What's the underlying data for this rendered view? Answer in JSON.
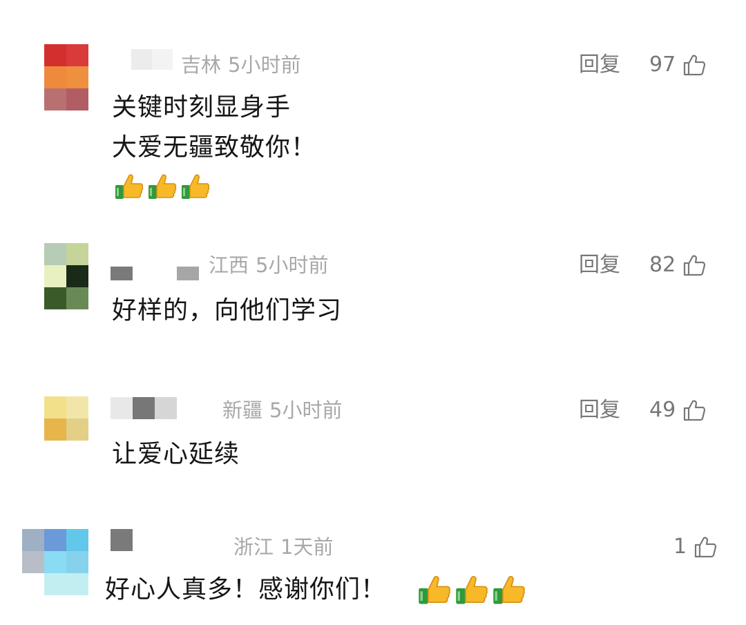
{
  "comments": [
    {
      "location": "吉林",
      "time": "5小时前",
      "reply_label": "回复",
      "likes": "97",
      "lines": [
        "关键时刻显身手",
        "大爱无疆致敬你！"
      ],
      "emoji": "thumbs-up-emoji",
      "emoji_count": 3,
      "avatar_colors": [
        "#d32f2f",
        "#d93a3a",
        "#ef8a3c",
        "#ee9040",
        "#b97070",
        "#b25d64"
      ]
    },
    {
      "location": "江西",
      "time": "5小时前",
      "reply_label": "回复",
      "likes": "82",
      "lines": [
        "好样的，向他们学习"
      ],
      "avatar_colors": [
        "#b7ccb4",
        "#c5d49a",
        "#e9f0c0",
        "#1a2a18",
        "#3a5a2a",
        "#6a8a55"
      ]
    },
    {
      "location": "新疆",
      "time": "5小时前",
      "reply_label": "回复",
      "likes": "49",
      "lines": [
        "让爱心延续"
      ],
      "avatar_colors": [
        "#f3e08a",
        "#f1e6a8",
        "#e6b64a",
        "#e3cf86"
      ]
    },
    {
      "location": "浙江",
      "time": "1天前",
      "likes": "1",
      "lines": [
        "好心人真多！感谢你们！"
      ],
      "emoji": "thumbs-up-emoji",
      "emoji_count": 3,
      "avatar_colors": [
        "#9fb0c4",
        "#6a9ad8",
        "#62c8ea",
        "#b8bec8",
        "#8adcf4",
        "#86d2ec",
        "#ffffff",
        "#c2eef2",
        "#ffffff"
      ]
    }
  ],
  "colors": {
    "meta_text": "#a8a8a8",
    "action_text": "#777777",
    "body_text": "#161616",
    "background": "#ffffff"
  }
}
